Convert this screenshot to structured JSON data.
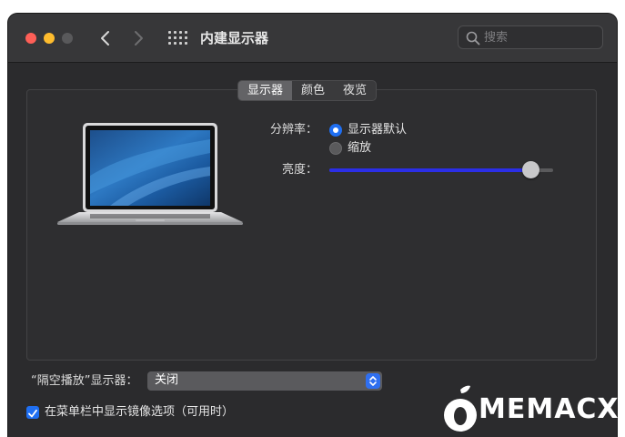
{
  "window": {
    "title": "内建显示器"
  },
  "search": {
    "placeholder": "搜索"
  },
  "tabs": [
    {
      "label": "显示器",
      "active": true
    },
    {
      "label": "颜色",
      "active": false
    },
    {
      "label": "夜览",
      "active": false
    }
  ],
  "resolution": {
    "label": "分辨率：",
    "options": [
      {
        "label": "显示器默认",
        "selected": true
      },
      {
        "label": "缩放",
        "selected": false
      }
    ]
  },
  "brightness": {
    "label": "亮度：",
    "value_fraction": 0.9
  },
  "airplay": {
    "label": "“隔空播放”显示器：",
    "selected": "关闭"
  },
  "mirroring": {
    "label": "在菜单栏中显示镜像选项（可用时）",
    "checked": true
  },
  "watermark": {
    "text": "MEMACX"
  },
  "colors": {
    "accent": "#1f6ff2",
    "slider_fill": "#2b2ee6",
    "close": "#fe5f57",
    "minimize": "#febc2e"
  }
}
